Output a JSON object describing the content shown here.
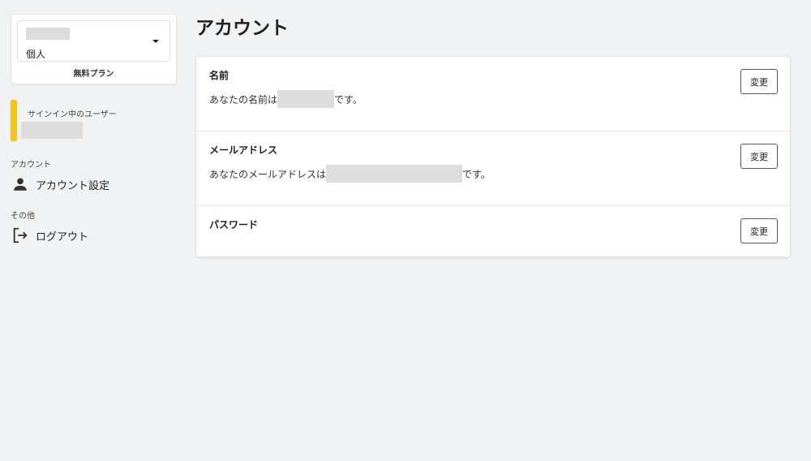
{
  "sidebar": {
    "workspace_type": "個人",
    "plan": "無料プラン",
    "signed_in_label": "サインイン中のユーザー",
    "sections": [
      {
        "label": "アカウント",
        "items": [
          {
            "label": "アカウント設定",
            "icon": "person-icon"
          }
        ]
      },
      {
        "label": "その他",
        "items": [
          {
            "label": "ログアウト",
            "icon": "logout-icon"
          }
        ]
      }
    ]
  },
  "main": {
    "title": "アカウント",
    "rows": [
      {
        "title": "名前",
        "desc_prefix": "あなたの名前は",
        "desc_suffix": "です。",
        "button": "変更"
      },
      {
        "title": "メールアドレス",
        "desc_prefix": "あなたのメールアドレスは",
        "desc_suffix": "です。",
        "button": "変更"
      },
      {
        "title": "パスワード",
        "button": "変更"
      }
    ]
  },
  "colors": {
    "accent_bar": "#f5c518",
    "background": "#f1f2f3"
  }
}
